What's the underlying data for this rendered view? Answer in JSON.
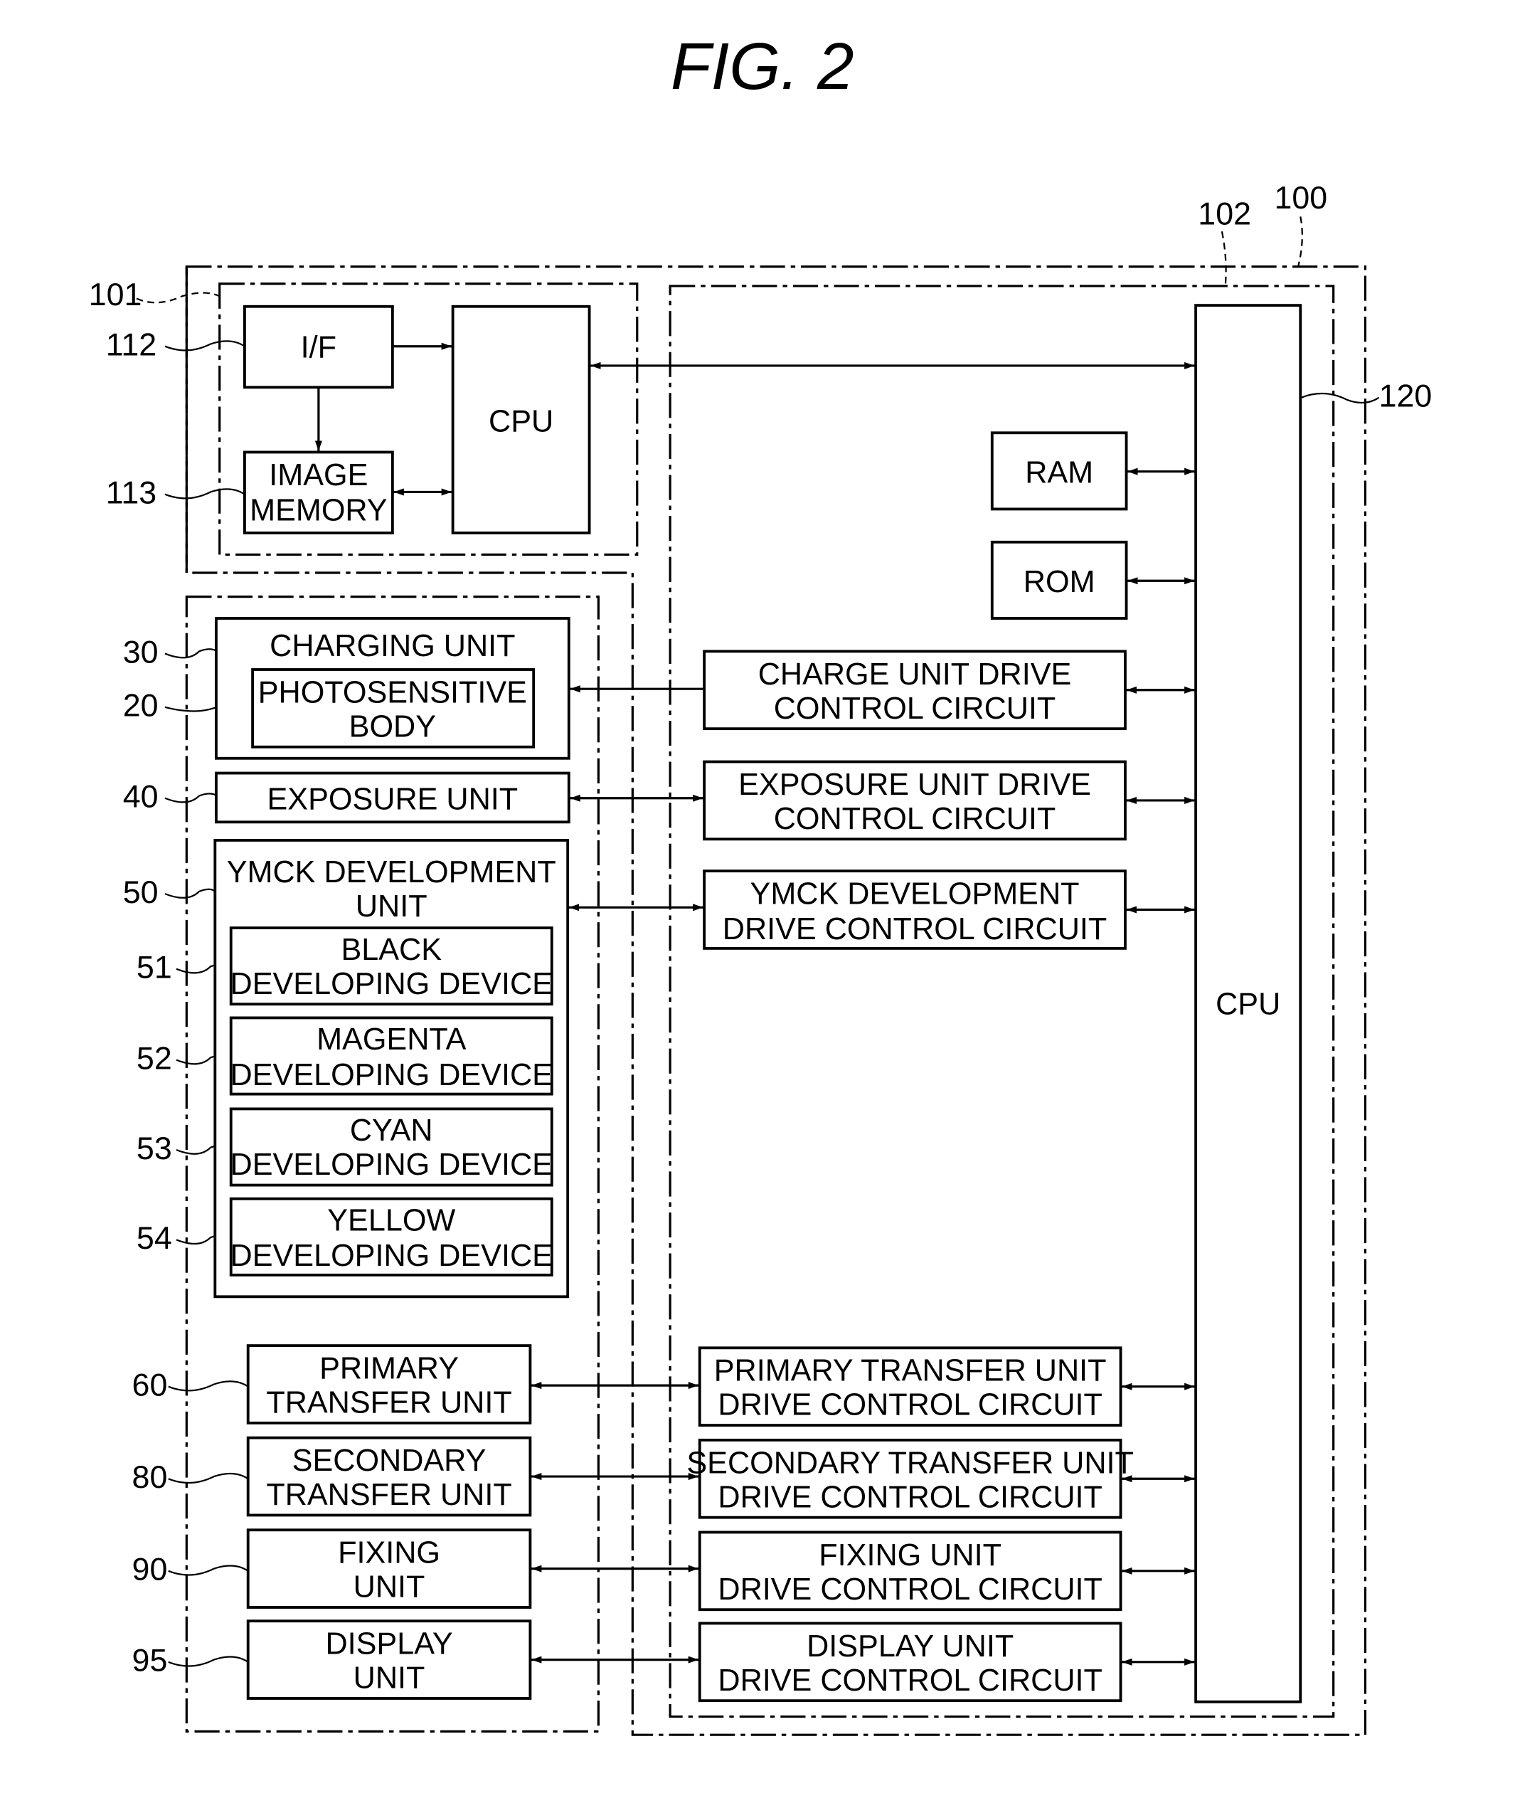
{
  "figure": {
    "title": "FIG. 2"
  },
  "ref_labels": {
    "r100": "100",
    "r101": "101",
    "r102": "102",
    "r112": "112",
    "r113": "113",
    "r120": "120",
    "r30": "30",
    "r20": "20",
    "r40": "40",
    "r50": "50",
    "r51": "51",
    "r52": "52",
    "r53": "53",
    "r54": "54",
    "r60": "60",
    "r80": "80",
    "r90": "90",
    "r95": "95"
  },
  "controller": {
    "if": "I/F",
    "image_memory": [
      "IMAGE",
      "MEMORY"
    ],
    "cpu": "CPU"
  },
  "engine": {
    "cpu": "CPU",
    "ram": "RAM",
    "rom": "ROM",
    "circuits": {
      "charge": [
        "CHARGE UNIT DRIVE",
        "CONTROL CIRCUIT"
      ],
      "exposure": [
        "EXPOSURE UNIT DRIVE",
        "CONTROL CIRCUIT"
      ],
      "ymck": [
        "YMCK DEVELOPMENT",
        "DRIVE CONTROL CIRCUIT"
      ],
      "primary": [
        "PRIMARY TRANSFER UNIT",
        "DRIVE CONTROL CIRCUIT"
      ],
      "secondary": [
        "SECONDARY TRANSFER UNIT",
        "DRIVE CONTROL CIRCUIT"
      ],
      "fixing": [
        "FIXING UNIT",
        "DRIVE CONTROL CIRCUIT"
      ],
      "display": [
        "DISPLAY UNIT",
        "DRIVE CONTROL CIRCUIT"
      ]
    }
  },
  "units": {
    "charging": "CHARGING UNIT",
    "photosensitive": [
      "PHOTOSENSITIVE",
      "BODY"
    ],
    "exposure": "EXPOSURE UNIT",
    "ymck": [
      "YMCK DEVELOPMENT",
      "UNIT"
    ],
    "black": [
      "BLACK",
      "DEVELOPING DEVICE"
    ],
    "magenta": [
      "MAGENTA",
      "DEVELOPING DEVICE"
    ],
    "cyan": [
      "CYAN",
      "DEVELOPING DEVICE"
    ],
    "yellow": [
      "YELLOW",
      "DEVELOPING DEVICE"
    ],
    "primary": [
      "PRIMARY",
      "TRANSFER UNIT"
    ],
    "secondary": [
      "SECONDARY",
      "TRANSFER UNIT"
    ],
    "fixing": [
      "FIXING",
      "UNIT"
    ],
    "display": [
      "DISPLAY",
      "UNIT"
    ]
  }
}
